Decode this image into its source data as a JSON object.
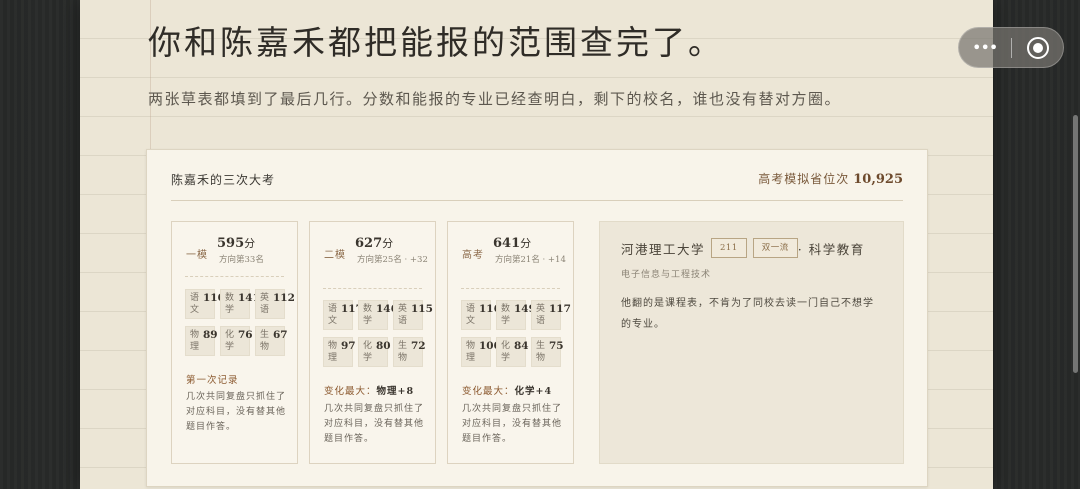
{
  "header": {
    "top_fragment": "",
    "title": "你和陈嘉禾都把能报的范围查完了。",
    "subtitle": "两张草表都填到了最后几行。分数和能报的专业已经查明白，剩下的校名，谁也没有替对方圈。"
  },
  "card": {
    "title": "陈嘉禾的三次大考",
    "rank_label": "高考模拟省位次",
    "rank_value": "10,925",
    "exams": [
      {
        "label": "一模",
        "score": "595",
        "unit": "分",
        "rank": "方向第33名",
        "subjects": [
          {
            "name": "语文",
            "value": "110"
          },
          {
            "name": "数学",
            "value": "141"
          },
          {
            "name": "英语",
            "value": "112"
          },
          {
            "name": "物理",
            "value": "89"
          },
          {
            "name": "化学",
            "value": "76"
          },
          {
            "name": "生物",
            "value": "67"
          }
        ],
        "note_title": "第一次记录",
        "note_highlight": "",
        "note": "几次共同复盘只抓住了对应科目，没有替其他题目作答。"
      },
      {
        "label": "二模",
        "score": "627",
        "unit": "分",
        "rank": "方向第25名 · +32",
        "subjects": [
          {
            "name": "语文",
            "value": "117"
          },
          {
            "name": "数学",
            "value": "146"
          },
          {
            "name": "英语",
            "value": "115"
          },
          {
            "name": "物理",
            "value": "97"
          },
          {
            "name": "化学",
            "value": "80"
          },
          {
            "name": "生物",
            "value": "72"
          }
        ],
        "note_title": "变化最大：",
        "note_highlight": "物理+8",
        "note": "几次共同复盘只抓住了对应科目，没有替其他题目作答。"
      },
      {
        "label": "高考",
        "score": "641",
        "unit": "分",
        "rank": "方向第21名 · +14",
        "subjects": [
          {
            "name": "语文",
            "value": "116"
          },
          {
            "name": "数学",
            "value": "149"
          },
          {
            "name": "英语",
            "value": "117"
          },
          {
            "name": "物理",
            "value": "100"
          },
          {
            "name": "化学",
            "value": "84"
          },
          {
            "name": "生物",
            "value": "75"
          }
        ],
        "note_title": "变化最大：",
        "note_highlight": "化学+4",
        "note": "几次共同复盘只抓住了对应科目，没有替其他题目作答。"
      }
    ],
    "school": {
      "name": "河港理工大学",
      "tag1": "211",
      "tag2": "双一流",
      "suffix": "· 科学教育",
      "subtitle": "电子信息与工程技术",
      "note": "他翻的是课程表，不肯为了同校去读一门自己不想学的专业。"
    }
  },
  "capsule": {
    "more_icon": "more-dots-icon",
    "close_icon": "target-circle-icon"
  },
  "colors": {
    "paper": "#ece6d6",
    "card": "#f8f4ea",
    "accent": "#8c6a4a"
  }
}
